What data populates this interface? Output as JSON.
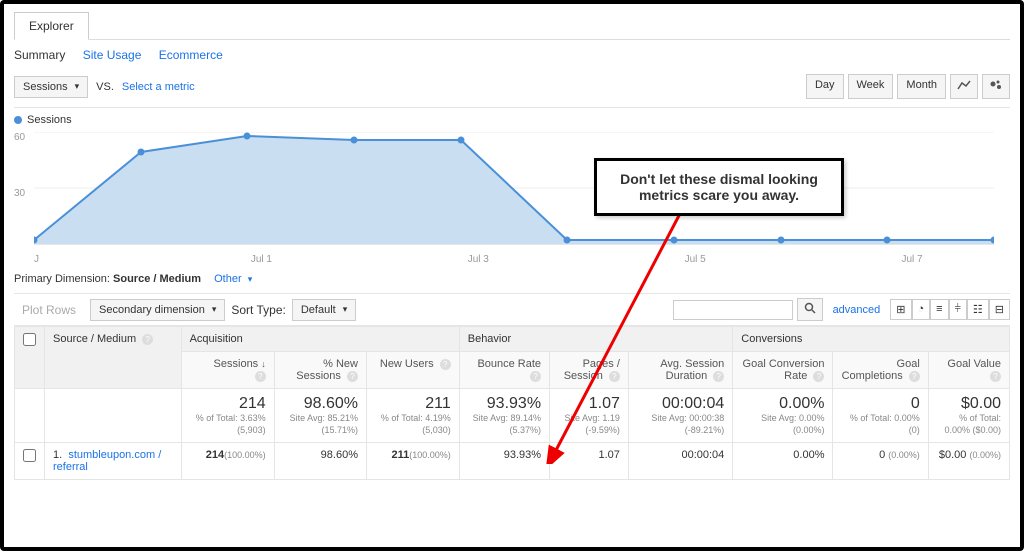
{
  "tabs": {
    "explorer": "Explorer"
  },
  "subtabs": {
    "summary": "Summary",
    "siteUsage": "Site Usage",
    "ecommerce": "Ecommerce"
  },
  "controls": {
    "metricSelector": "Sessions",
    "vs": "VS.",
    "selectMetric": "Select a metric",
    "day": "Day",
    "week": "Week",
    "month": "Month"
  },
  "legend": {
    "sessions": "Sessions"
  },
  "chart_data": {
    "type": "area",
    "categories": [
      "J",
      "",
      "Jul 1",
      "",
      "Jul 3",
      "",
      "Jul 5",
      "",
      "Jul 7",
      ""
    ],
    "values": [
      2,
      50,
      59,
      57,
      57,
      2,
      2,
      2,
      2,
      2
    ],
    "ylabel": "",
    "xlabel": "",
    "ylim": [
      0,
      60
    ],
    "yticks": [
      30,
      60
    ]
  },
  "primaryDimension": {
    "label": "Primary Dimension:",
    "value": "Source / Medium",
    "other": "Other"
  },
  "filterRow": {
    "plotRows": "Plot Rows",
    "secondaryDim": "Secondary dimension",
    "sortTypeLabel": "Sort Type:",
    "sortDefault": "Default",
    "advanced": "advanced",
    "searchPlaceholder": ""
  },
  "table": {
    "col1": "Source / Medium",
    "groups": {
      "acq": "Acquisition",
      "beh": "Behavior",
      "conv": "Conversions"
    },
    "headers": {
      "sessions": "Sessions",
      "pctNew": "% New Sessions",
      "newUsers": "New Users",
      "bounce": "Bounce Rate",
      "pages": "Pages / Session",
      "avgDur": "Avg. Session Duration",
      "gcr": "Goal Conversion Rate",
      "gc": "Goal Completions",
      "gv": "Goal Value"
    },
    "summary": {
      "sessions_big": "214",
      "sessions_sub": "% of Total: 3.63% (5,903)",
      "pctNew_big": "98.60%",
      "pctNew_sub": "Site Avg: 85.21% (15.71%)",
      "newUsers_big": "211",
      "newUsers_sub": "% of Total: 4.19% (5,030)",
      "bounce_big": "93.93%",
      "bounce_sub": "Site Avg: 89.14% (5.37%)",
      "pages_big": "1.07",
      "pages_sub": "Site Avg: 1.19 (-9.59%)",
      "avgDur_big": "00:00:04",
      "avgDur_sub": "Site Avg: 00:00:38 (-89.21%)",
      "gcr_big": "0.00%",
      "gcr_sub": "Site Avg: 0.00% (0.00%)",
      "gc_big": "0",
      "gc_sub": "% of Total: 0.00% (0)",
      "gv_big": "$0.00",
      "gv_sub": "% of Total: 0.00% ($0.00)"
    },
    "row1": {
      "idx": "1.",
      "source": "stumbleupon.com / referral",
      "sessions": "214",
      "sessions_pct": "(100.00%)",
      "pctNew": "98.60%",
      "newUsers": "211",
      "newUsers_pct": "(100.00%)",
      "bounce": "93.93%",
      "pages": "1.07",
      "avgDur": "00:00:04",
      "gcr": "0.00%",
      "gc": "0",
      "gc_pct": "(0.00%)",
      "gv": "$0.00",
      "gv_pct": "(0.00%)"
    }
  },
  "annotation": {
    "line1": "Don't let these dismal looking",
    "line2": "metrics scare you away."
  }
}
